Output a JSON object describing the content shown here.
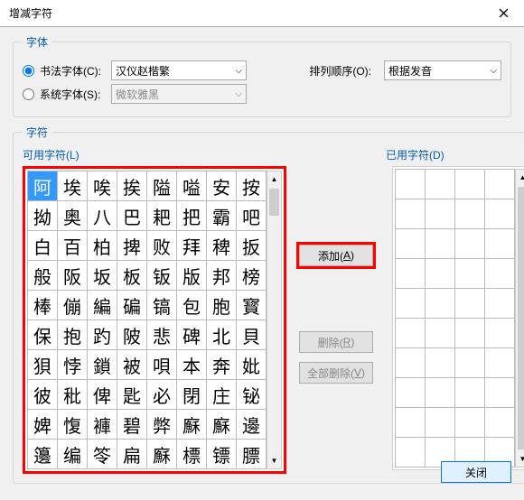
{
  "title": "增减字符",
  "group_font": "字体",
  "radio1": "书法字体(C):",
  "radio2": "系统字体(S):",
  "dd1": "汉仪赵楷繁",
  "dd2": "微软雅黑",
  "sortlabel": "排列顺序(O):",
  "dd3": "根据发音",
  "group_chars": "字符",
  "leftlabel": "可用字符(L)",
  "rightlabel": "已用字符(D)",
  "btn_add_pre": "添加(",
  "btn_add_hk": "A",
  "btn_add_post": ")",
  "btn_del_pre": "删除(",
  "btn_del_hk": "R",
  "btn_del_post": ")",
  "btn_delall_pre": "全部删除(",
  "btn_delall_hk": "V",
  "btn_delall_post": ")",
  "btn_close": "关闭",
  "cells": [
    "阿",
    "埃",
    "唉",
    "挨",
    "隘",
    "嗌",
    "安",
    "按",
    "拗",
    "奥",
    "八",
    "巴",
    "耙",
    "把",
    "霸",
    "吧",
    "白",
    "百",
    "柏",
    "捭",
    "败",
    "拜",
    "稗",
    "扳",
    "般",
    "阪",
    "坂",
    "板",
    "钣",
    "版",
    "邦",
    "榜",
    "棒",
    "傰",
    "編",
    "碥",
    "镐",
    "包",
    "胞",
    "寳",
    "保",
    "抱",
    "趵",
    "陂",
    "悲",
    "碑",
    "北",
    "貝",
    "狽",
    "悖",
    "鎖",
    "被",
    "唄",
    "本",
    "奔",
    "妣",
    "彼",
    "秕",
    "俾",
    "匙",
    "必",
    "閉",
    "庄",
    "铋",
    "婢",
    "愎",
    "褲",
    "碧",
    "弊",
    "㢝",
    "㢝",
    "邊",
    "籩",
    "编",
    "笭",
    "扁",
    "㢝",
    "標",
    "镖",
    "膘"
  ],
  "chart_data": {
    "type": "table",
    "title": "可用字符",
    "columns": 8,
    "rows": 10,
    "cells": [
      "阿",
      "埃",
      "唉",
      "挨",
      "隘",
      "嗌",
      "安",
      "按",
      "拗",
      "奥",
      "八",
      "巴",
      "耙",
      "把",
      "霸",
      "吧",
      "白",
      "百",
      "柏",
      "捭",
      "败",
      "拜",
      "稗",
      "扳",
      "般",
      "阪",
      "坂",
      "板",
      "钣",
      "版",
      "邦",
      "榜",
      "棒",
      "傰",
      "編",
      "碥",
      "镐",
      "包",
      "胞",
      "寳",
      "保",
      "抱",
      "趵",
      "陂",
      "悲",
      "碑",
      "北",
      "貝",
      "狽",
      "悖",
      "鎖",
      "被",
      "唄",
      "本",
      "奔",
      "妣",
      "彼",
      "秕",
      "俾",
      "匙",
      "必",
      "閉",
      "庄",
      "铋",
      "婢",
      "愎",
      "褲",
      "碧",
      "弊",
      "㢝",
      "㢝",
      "邊",
      "籩",
      "编",
      "笭",
      "扁",
      "㢝",
      "標",
      "镖",
      "膘"
    ]
  }
}
